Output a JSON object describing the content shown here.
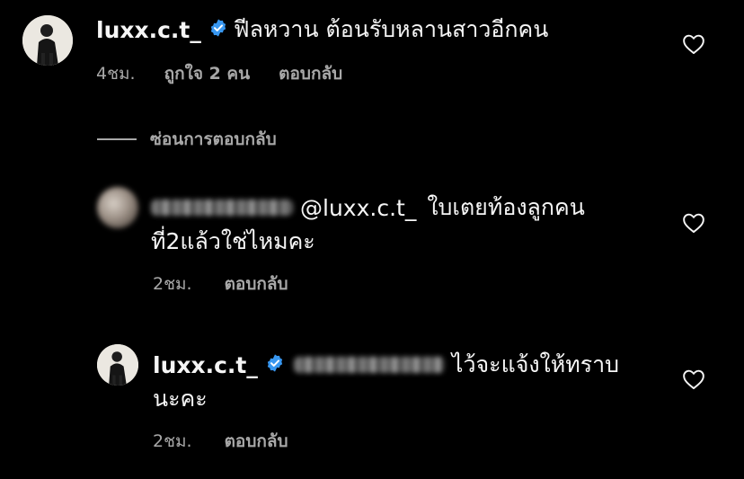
{
  "comments": [
    {
      "username": "luxx.c.t_",
      "text": "ฟีลหวาน ต้อนรับหลานสาวอีกคน",
      "time": "4ชม.",
      "likes": "ถูกใจ 2 คน",
      "reply_label": "ตอบกลับ"
    }
  ],
  "hide_replies_label": "ซ่อนการตอบกลับ",
  "replies": [
    {
      "mention": "@luxx.c.t_",
      "text_line1": "ใบเตยท้องลูกคน",
      "text_line2": "ที่2แล้วใช่ไหมคะ",
      "time": "2ชม.",
      "reply_label": "ตอบกลับ"
    },
    {
      "username": "luxx.c.t_",
      "text_line1": "ไว้จะแจ้งให้ทราบ",
      "text_line2": "นะคะ",
      "time": "2ชม.",
      "reply_label": "ตอบกลับ"
    }
  ],
  "colors": {
    "background": "#000000",
    "text": "#f5f5f5",
    "meta": "#a8a8a8",
    "verified": "#3897f0"
  },
  "icons": [
    "verified-badge-icon",
    "heart-icon"
  ]
}
